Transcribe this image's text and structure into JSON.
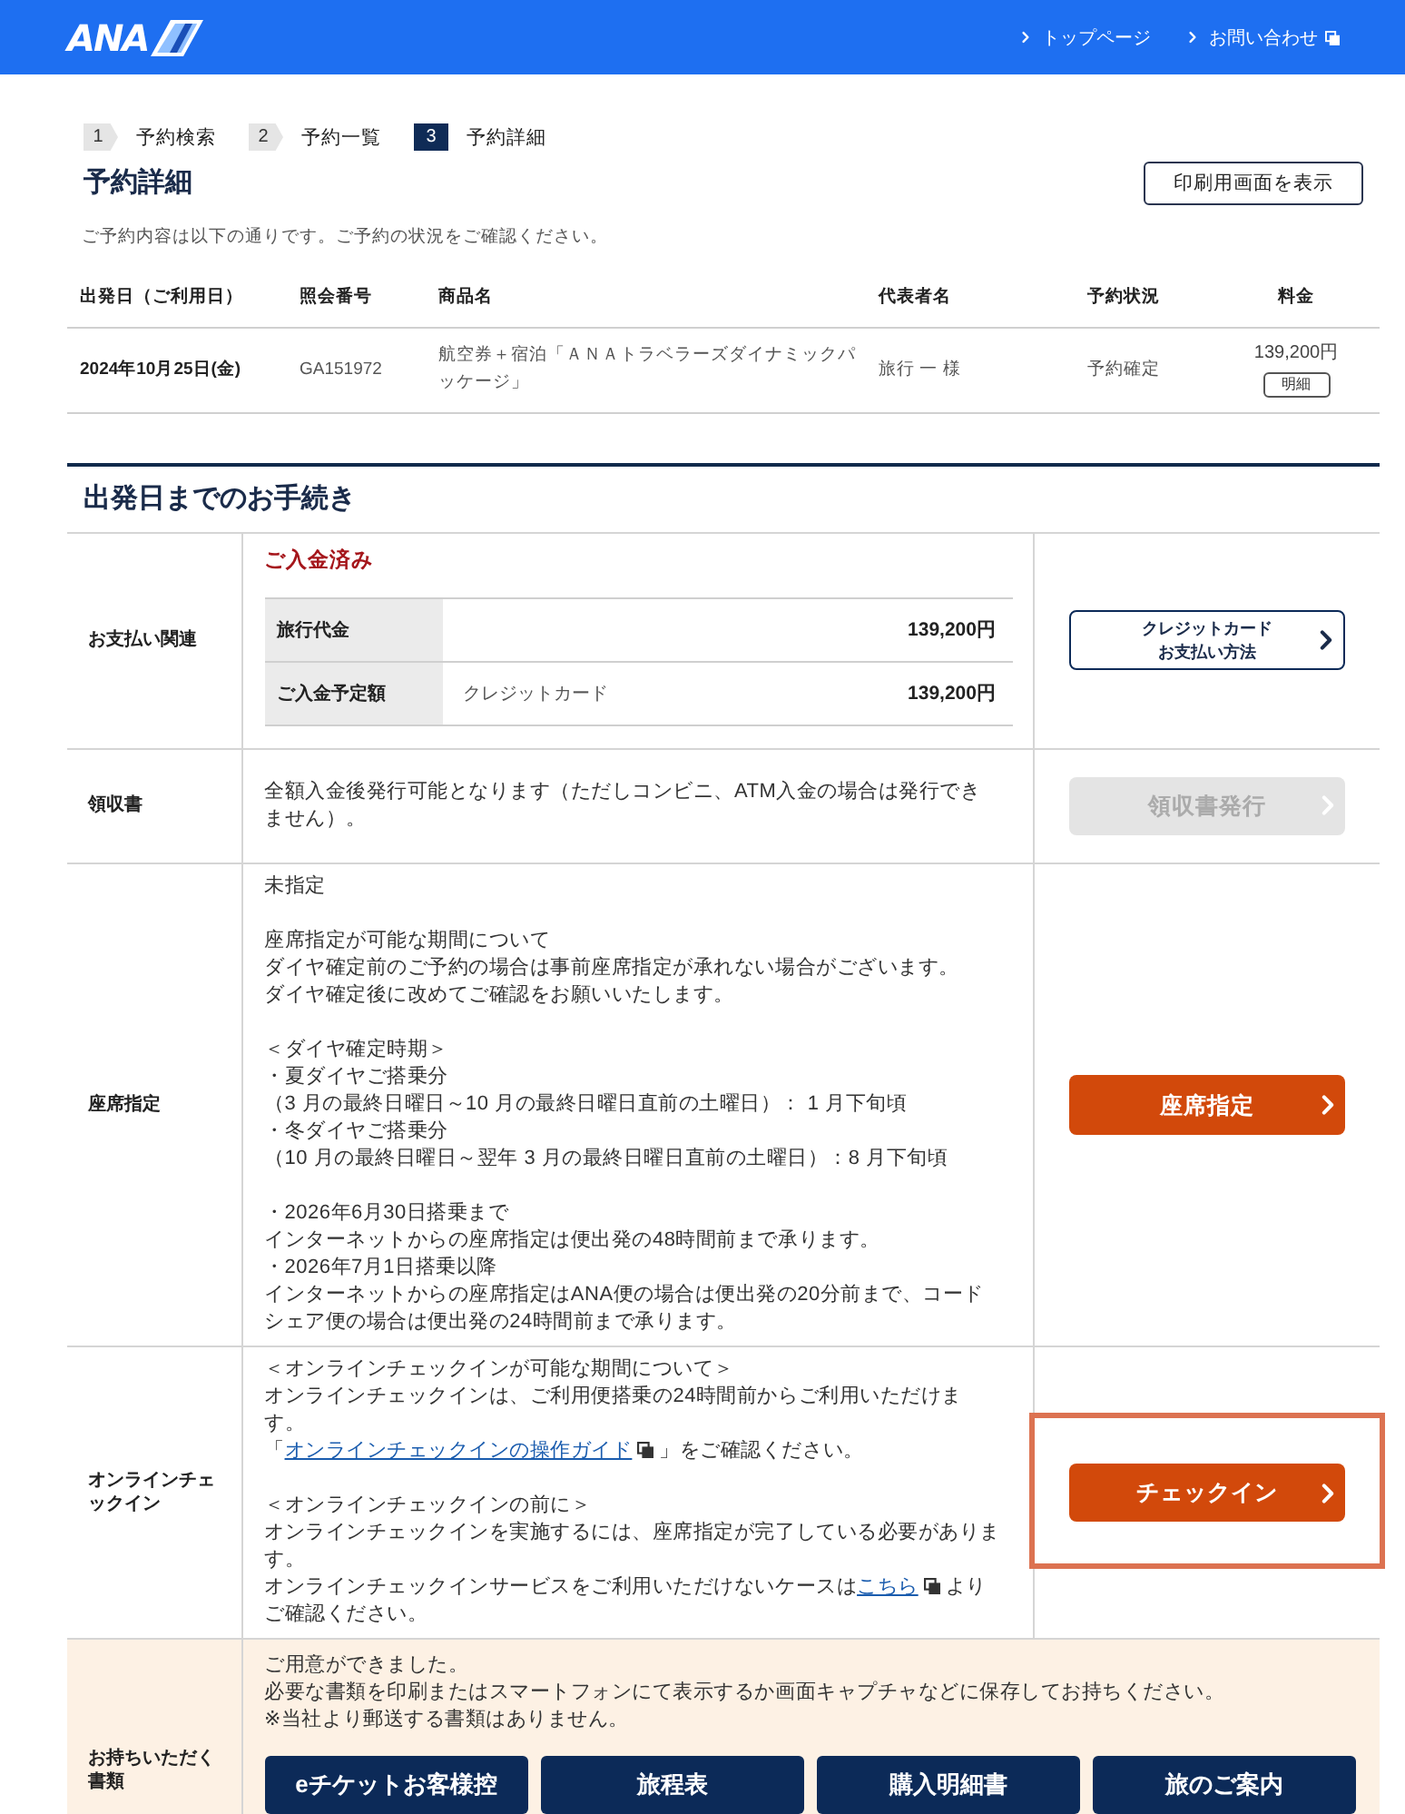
{
  "header": {
    "logo": "ANA",
    "links": [
      {
        "label": "トップページ",
        "external": false
      },
      {
        "label": "お問い合わせ",
        "external": true
      }
    ]
  },
  "steps": [
    {
      "number": "1",
      "label": "予約検索",
      "selected": false
    },
    {
      "number": "2",
      "label": "予約一覧",
      "selected": false
    },
    {
      "number": "3",
      "label": "予約詳細",
      "selected": true
    }
  ],
  "page_title": "予約詳細",
  "print_button": "印刷用画面を表示",
  "intro": "ご予約内容は以下の通りです。ご予約の状況をご確認ください。",
  "reservation_table": {
    "columns": [
      "出発日（ご利用日）",
      "照会番号",
      "商品名",
      "代表者名",
      "予約状況",
      "料金"
    ],
    "rows": [
      {
        "departure": "2024年10月25日(金)",
        "reference": "GA151972",
        "product": "航空券＋宿泊「ＡＮＡトラベラーズダイナミックパッケージ」",
        "representative": "旅行 一 様",
        "status": "予約確定",
        "price": "139,200円",
        "detail_button": "明細"
      }
    ]
  },
  "procedures": {
    "title": "出発日までのお手続き",
    "sections": [
      {
        "kind": "payment",
        "label": "お支払い関連",
        "status": "ご入金済み",
        "amounts": [
          {
            "label": "旅行代金",
            "amount": "139,200円"
          },
          {
            "label": "ご入金予定額",
            "method": "クレジットカード",
            "amount": "139,200円"
          }
        ],
        "action": {
          "kind": "outline",
          "lines": [
            "クレジットカード",
            "お支払い方法"
          ],
          "disabled": false
        }
      },
      {
        "kind": "notes",
        "label": "領収書",
        "paragraphs": [
          [
            "全額入金後発行可能となります（ただしコンビニ、ATM入金の場合は発行できません）。"
          ]
        ],
        "action": {
          "kind": "primary",
          "lines": [
            "領収書発行"
          ],
          "disabled": true
        }
      },
      {
        "kind": "notes",
        "label": "座席指定",
        "paragraphs": [
          [
            "未指定"
          ],
          [
            "座席指定が可能な期間について",
            "ダイヤ確定前のご予約の場合は事前座席指定が承れない場合がございます。",
            "ダイヤ確定後に改めてご確認をお願いいたします。"
          ],
          [
            "＜ダイヤ確定時期＞",
            "・夏ダイヤご搭乗分",
            "（3 月の最終日曜日～10 月の最終日曜日直前の土曜日）： 1 月下旬頃",
            "・冬ダイヤご搭乗分",
            "（10 月の最終日曜日～翌年 3 月の最終日曜日直前の土曜日）：8 月下旬頃"
          ],
          [
            "・2026年6月30日搭乗まで",
            "インターネットからの座席指定は便出発の48時間前まで承ります。",
            "・2026年7月1日搭乗以降",
            "インターネットからの座席指定はANA便の場合は便出発の20分前まで、コードシェア便の場合は便出発の24時間前まで承ります。"
          ]
        ],
        "action": {
          "kind": "primary",
          "lines": [
            "座席指定"
          ],
          "disabled": false
        }
      },
      {
        "kind": "notes",
        "label": "オンラインチェックイン",
        "paragraphs": [
          [
            "＜オンラインチェックインが可能な期間について＞",
            "オンラインチェックインは、ご利用便搭乗の24時間前からご利用いただけます。",
            {
              "segments": [
                {
                  "kind": "text",
                  "text": "「"
                },
                {
                  "kind": "link",
                  "text": "オンラインチェックインの操作ガイド",
                  "external": true
                },
                {
                  "kind": "text",
                  "text": "」をご確認ください。"
                }
              ]
            }
          ],
          [
            "＜オンラインチェックインの前に＞",
            "オンラインチェックインを実施するには、座席指定が完了している必要があります。",
            {
              "segments": [
                {
                  "kind": "text",
                  "text": "オンラインチェックインサービスをご利用いただけないケースは"
                },
                {
                  "kind": "link",
                  "text": "こちら",
                  "external": true
                },
                {
                  "kind": "text",
                  "text": "よりご確認ください。"
                }
              ]
            }
          ]
        ],
        "action": {
          "kind": "primary",
          "lines": [
            "チェックイン"
          ],
          "disabled": false,
          "highlighted": true
        }
      },
      {
        "kind": "documents",
        "label": "お持ちいただく書類",
        "paragraphs": [
          [
            "ご用意ができました。",
            "必要な書類を印刷またはスマートフォンにて表示するか画面キャプチャなどに保存してお持ちください。",
            "※当社より郵送する書類はありません。"
          ]
        ],
        "buttons": [
          "eチケットお客様控",
          "旅程表",
          "購入明細書",
          "旅のご案内"
        ]
      }
    ]
  }
}
